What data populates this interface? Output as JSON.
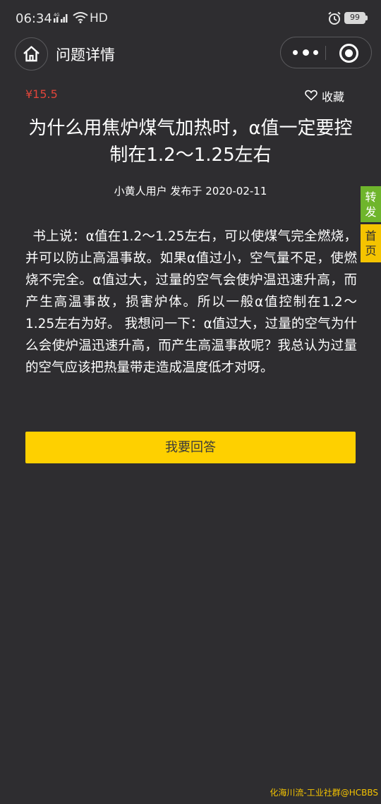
{
  "status_bar": {
    "time": "06:34",
    "network": "4G",
    "hd": "HD",
    "battery": "99"
  },
  "nav": {
    "title": "问题详情"
  },
  "question": {
    "price": "¥15.5",
    "collect_label": "收藏",
    "title": "为什么用焦炉煤气加热时，α值一定要控制在1.2～1.25左右",
    "author": "小黄人用户",
    "published_prefix": "发布于",
    "date": "2020-02-11",
    "body": "书上说：α值在1.2～1.25左右，可以使煤气完全燃烧，并可以防止高温事故。如果α值过小，空气量不足，使燃烧不完全。α值过大，过量的空气会使炉温迅速升高，而产生高温事故，损害炉体。所以一般α值控制在1.2～1.25左右为好。 我想问一下：α值过大，过量的空气为什么会使炉温迅速升高，而产生高温事故呢？我总认为过量的空气应该把热量带走造成温度低才对呀。"
  },
  "actions": {
    "answer_label": "我要回答"
  },
  "side_tabs": {
    "share": "转发",
    "home": "首页"
  },
  "watermark": "化海川流-工业社群@HCBBS",
  "colors": {
    "background": "#2e2d30",
    "price": "#e0453a",
    "answer_button": "#fed000",
    "share_tab": "#6fb52c",
    "home_tab": "#f5c400"
  }
}
